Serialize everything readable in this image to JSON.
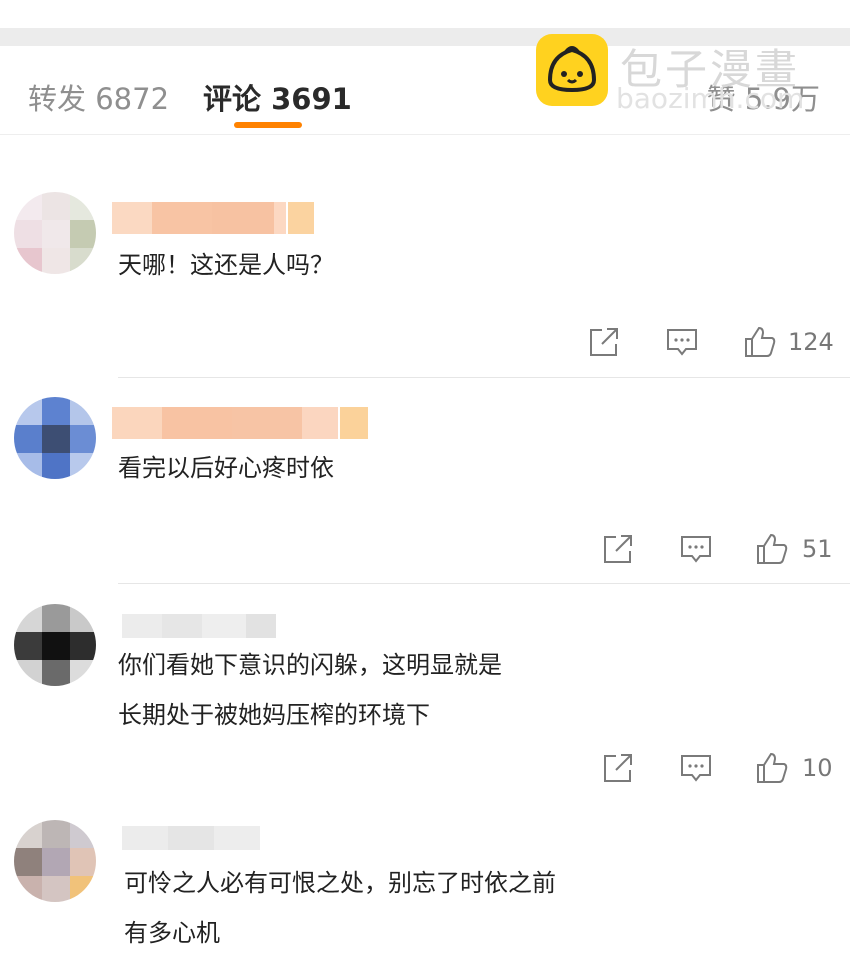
{
  "tabs": {
    "repost": "转发 6872",
    "comments": "评论 3691",
    "likes": "赞 5.9万"
  },
  "watermark": {
    "cn": "包子漫畫",
    "en": "baozimh.com"
  },
  "colors": {
    "accent": "#ff8200",
    "logo": "#ffd21f"
  },
  "comments": [
    {
      "lines": [
        "天哪！这还是人吗？"
      ],
      "likes": "124"
    },
    {
      "lines": [
        "看完以后好心疼时依"
      ],
      "likes": "51"
    },
    {
      "lines": [
        "你们看她下意识的闪躲，这明显就是",
        "长期处于被她妈压榨的环境下"
      ],
      "likes": "10"
    },
    {
      "lines": [
        "可怜之人必有可恨之处，别忘了时依之前",
        "有多心机"
      ]
    }
  ],
  "icons": {
    "share": "share-icon",
    "reply": "comment-icon",
    "like": "thumbs-up-icon"
  }
}
